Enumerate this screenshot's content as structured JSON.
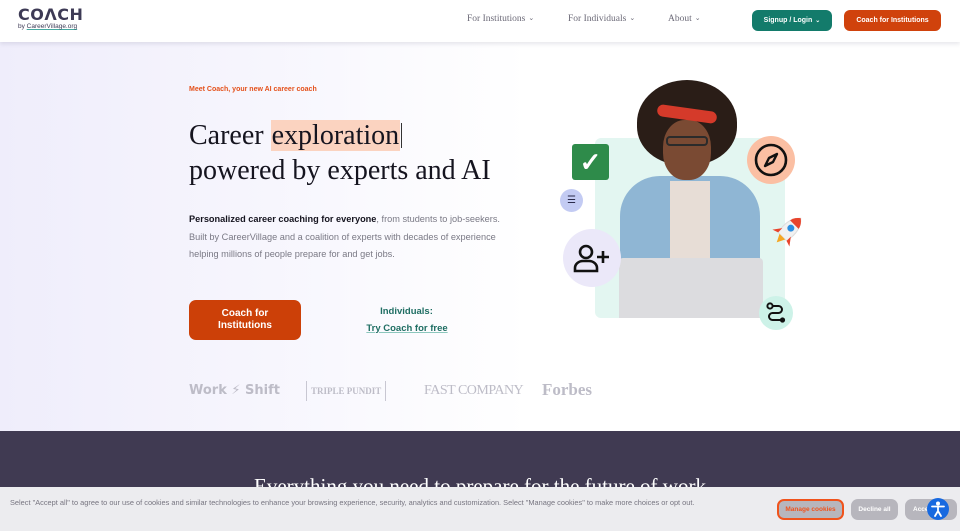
{
  "header": {
    "logo_main": "COΛCH",
    "logo_by": "by ",
    "logo_org": "CareerVillage.org",
    "nav": [
      {
        "label": "For Institutions"
      },
      {
        "label": "For Individuals"
      },
      {
        "label": "About"
      }
    ],
    "signup_label": "Signup / Login",
    "cta_label": "Coach for Institutions"
  },
  "hero": {
    "eyebrow": "Meet Coach, your new AI career coach",
    "headline_pre": "Career ",
    "headline_highlight": "exploration",
    "headline_line2": "powered by experts and AI",
    "desc_bold": "Personalized career coaching for everyone",
    "desc_rest": ", from students to job-seekers. Built by CareerVillage and a coalition of experts with decades of experience helping millions of people prepare for and get jobs.",
    "cta_line1": "Coach for",
    "cta_line2": "Institutions",
    "individuals_label": "Individuals:",
    "individuals_link": "Try Coach for free",
    "press": [
      "Work ⚡ Shift",
      "TRIPLE PUNDIT",
      "FAST COMPANY",
      "Forbes"
    ]
  },
  "section2": {
    "title": "Everything you need to prepare for the future of work"
  },
  "cookie": {
    "text": "Select \"Accept all\" to agree to our use of cookies and similar technologies to enhance your browsing experience, security, analytics and customization. Select \"Manage cookies\" to make more choices or opt out.",
    "manage_label": "Manage cookies",
    "decline_label": "Decline all",
    "accept_label": "Accept all"
  },
  "colors": {
    "brand_orange": "#d0420c",
    "brand_teal": "#137b6b",
    "dark_section": "#403a52",
    "accessibility_blue": "#1769e0"
  }
}
